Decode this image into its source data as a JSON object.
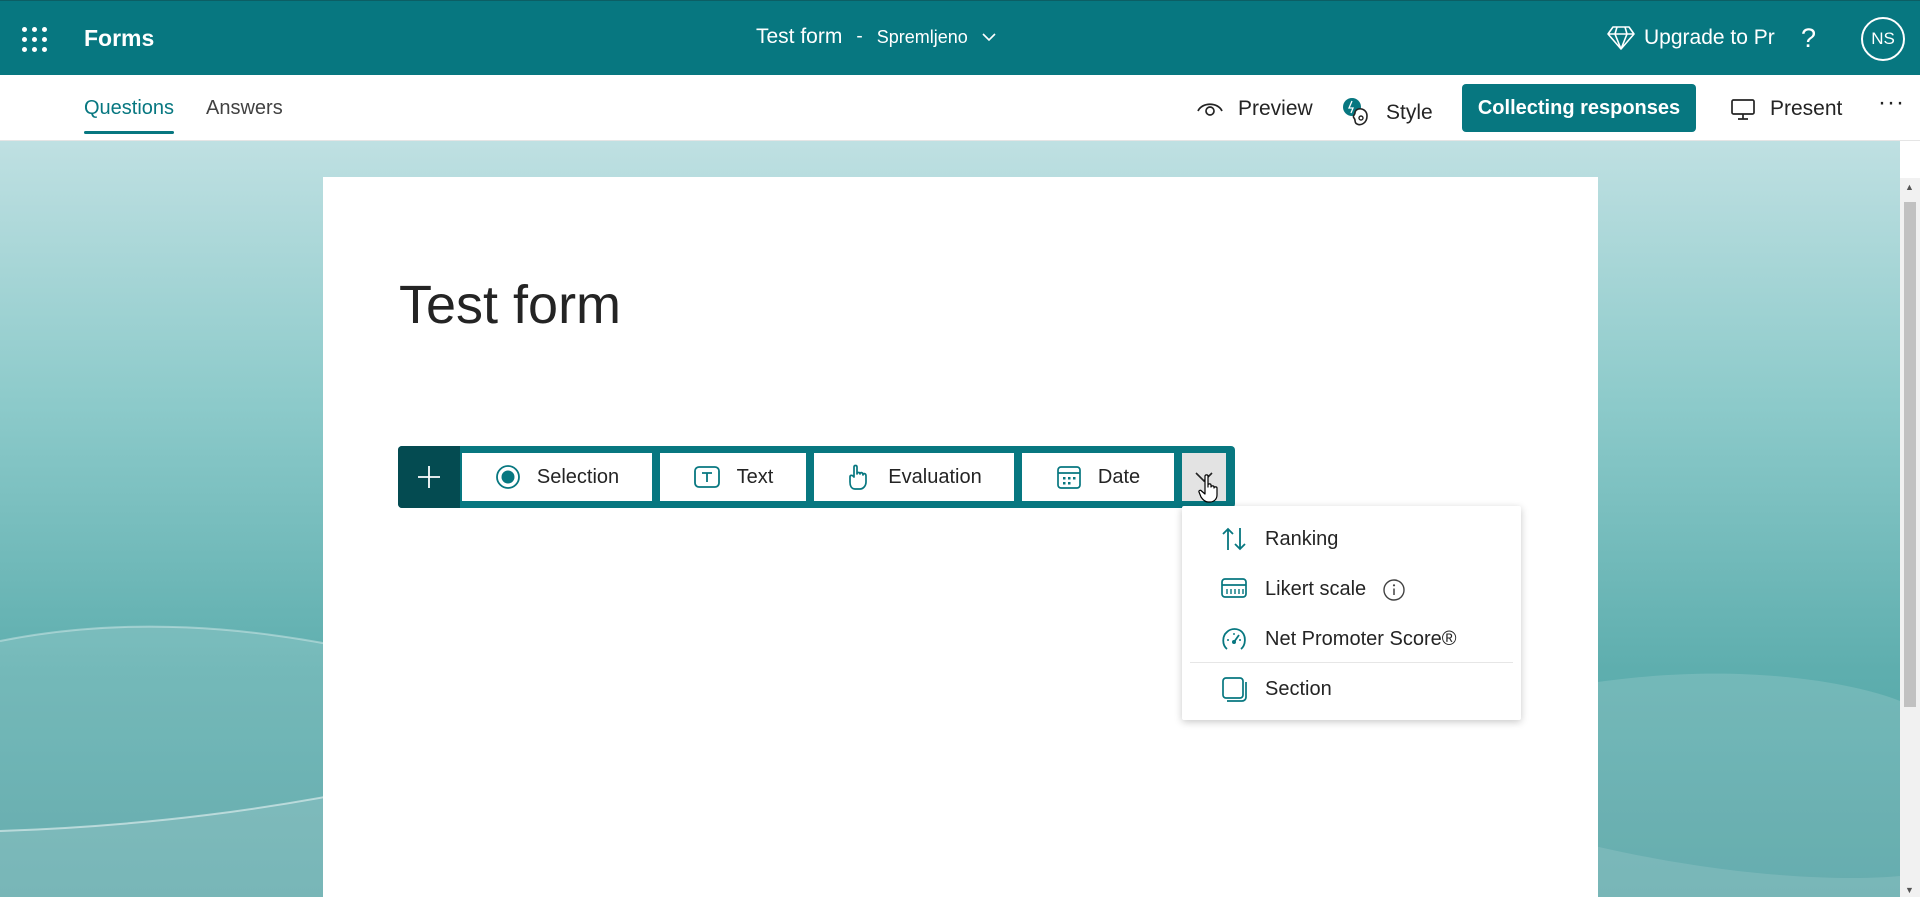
{
  "topbar": {
    "app_name": "Forms",
    "form_title": "Test form",
    "separator": "-",
    "save_status": "Spremljeno",
    "upgrade_label": "Upgrade to Pr",
    "help": "?",
    "avatar_initials": "NS"
  },
  "command_bar": {
    "tabs": [
      {
        "label": "Questions",
        "active": true
      },
      {
        "label": "Answers",
        "active": false
      }
    ],
    "preview": "Preview",
    "style": "Style",
    "collecting": "Collecting responses",
    "present": "Present",
    "more": "···"
  },
  "form": {
    "title": "Test form"
  },
  "add_question": {
    "options": [
      "Selection",
      "Text",
      "Evaluation",
      "Date"
    ]
  },
  "more_menu": {
    "items": [
      "Ranking",
      "Likert scale",
      "Net Promoter Score®",
      "Section"
    ]
  },
  "colors": {
    "brand": "#077780",
    "brand_dark": "#044b51"
  },
  "icons": {
    "app_launcher": "waffle-icon",
    "upgrade": "diamond-icon",
    "preview": "eye-icon",
    "style": "palette-icon",
    "present": "monitor-icon",
    "selection": "radio-icon",
    "text": "text-icon",
    "evaluation": "thumb-icon",
    "date": "calendar-icon",
    "ranking": "sort-arrows-icon",
    "likert": "grid-icon",
    "nps": "gauge-icon",
    "section": "section-icon"
  }
}
